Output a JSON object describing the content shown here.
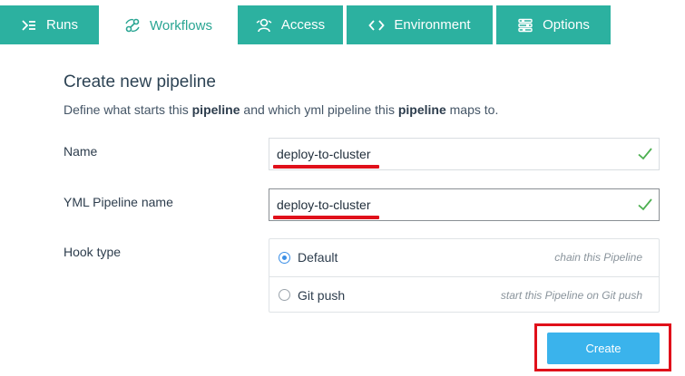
{
  "tabs": [
    {
      "label": "Runs",
      "icon": "runs-icon",
      "active": false
    },
    {
      "label": "Workflows",
      "icon": "workflows-icon",
      "active": true
    },
    {
      "label": "Access",
      "icon": "access-icon",
      "active": false
    },
    {
      "label": "Environment",
      "icon": "code-icon",
      "active": false
    },
    {
      "label": "Options",
      "icon": "sliders-icon",
      "active": false
    }
  ],
  "form": {
    "title": "Create new pipeline",
    "desc_part1": "Define what starts this ",
    "desc_bold1": "pipeline",
    "desc_part2": " and which yml pipeline this ",
    "desc_bold2": "pipeline",
    "desc_part3": " maps to.",
    "name_label": "Name",
    "name_value": "deploy-to-cluster",
    "yml_label": "YML Pipeline name",
    "yml_value": "deploy-to-cluster",
    "hook_label": "Hook type",
    "hook_options": [
      {
        "label": "Default",
        "hint": "chain this Pipeline",
        "selected": true
      },
      {
        "label": "Git push",
        "hint": "start this Pipeline on Git push",
        "selected": false
      }
    ],
    "create_label": "Create"
  },
  "colors": {
    "tab_bg": "#2cb1a0",
    "tab_active_text": "#2aa593",
    "primary_button": "#3ab3ec",
    "highlight_red": "#e0101a",
    "valid_check": "#4caf50"
  }
}
